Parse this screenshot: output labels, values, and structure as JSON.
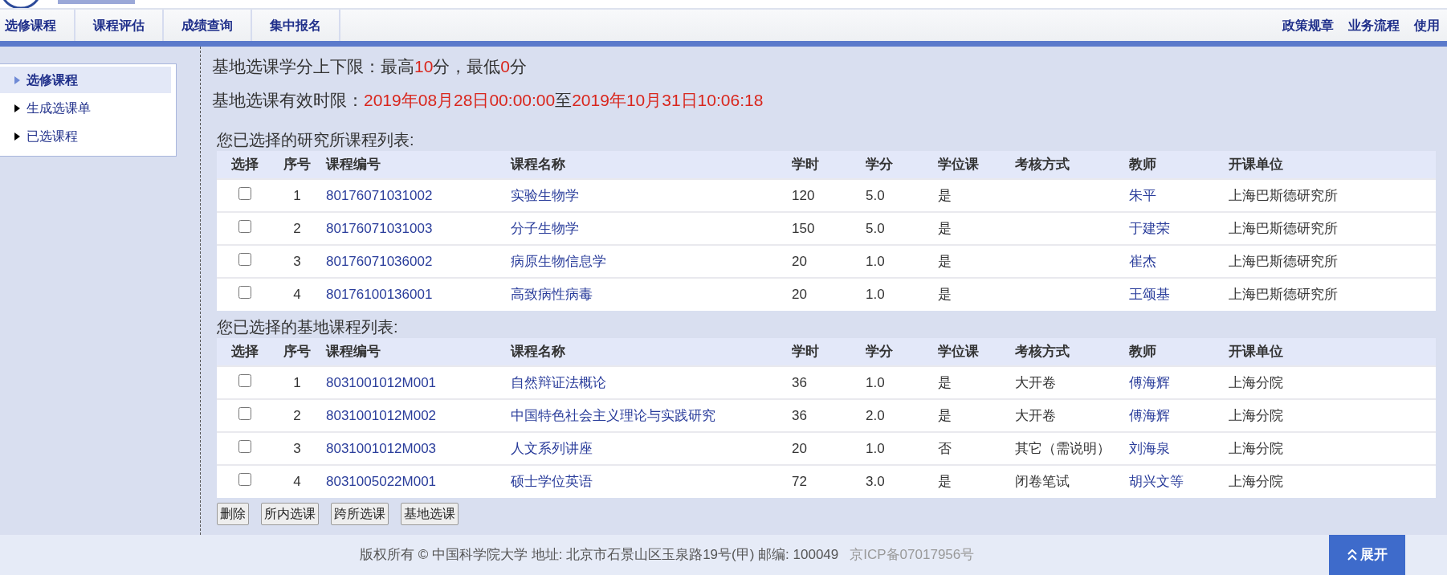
{
  "nav": {
    "left": [
      {
        "label": "选修课程"
      },
      {
        "label": "课程评估"
      },
      {
        "label": "成绩查询"
      },
      {
        "label": "集中报名"
      }
    ],
    "right": [
      {
        "label": "政策规章"
      },
      {
        "label": "业务流程"
      },
      {
        "label": "使用"
      }
    ]
  },
  "sidebar": {
    "items": [
      {
        "label": "选修课程",
        "selected": true
      },
      {
        "label": "生成选课单",
        "selected": false
      },
      {
        "label": "已选课程",
        "selected": false
      }
    ]
  },
  "notices": [
    {
      "segments": [
        {
          "text": "基地选课学分上下限：最高",
          "highlight": false
        },
        {
          "text": "10",
          "highlight": true
        },
        {
          "text": "分，最低",
          "highlight": false
        },
        {
          "text": "0",
          "highlight": true
        },
        {
          "text": "分",
          "highlight": false
        }
      ]
    },
    {
      "segments": [
        {
          "text": "基地选课有效时限：",
          "highlight": false
        },
        {
          "text": "2019年08月28日00:00:00",
          "highlight": true
        },
        {
          "text": "至",
          "highlight": false
        },
        {
          "text": "2019年10月31日10:06:18",
          "highlight": true
        }
      ]
    }
  ],
  "tables": [
    {
      "title": "您已选择的研究所课程列表:",
      "columns": [
        {
          "label": "选择",
          "kind": "check"
        },
        {
          "label": "序号",
          "kind": "index"
        },
        {
          "label": "课程编号",
          "kind": "link"
        },
        {
          "label": "课程名称",
          "kind": "link"
        },
        {
          "label": "学时",
          "kind": "text"
        },
        {
          "label": "学分",
          "kind": "text"
        },
        {
          "label": "学位课",
          "kind": "text"
        },
        {
          "label": "考核方式",
          "kind": "text"
        },
        {
          "label": "教师",
          "kind": "link"
        },
        {
          "label": "开课单位",
          "kind": "text"
        }
      ],
      "rows": [
        {
          "checked": false,
          "cells": [
            "",
            "1",
            "80176071031002",
            "实验生物学",
            "120",
            "5.0",
            "是",
            "",
            "朱平",
            "上海巴斯德研究所"
          ]
        },
        {
          "checked": false,
          "cells": [
            "",
            "2",
            "80176071031003",
            "分子生物学",
            "150",
            "5.0",
            "是",
            "",
            "于建荣",
            "上海巴斯德研究所"
          ]
        },
        {
          "checked": false,
          "cells": [
            "",
            "3",
            "80176071036002",
            "病原生物信息学",
            "20",
            "1.0",
            "是",
            "",
            "崔杰",
            "上海巴斯德研究所"
          ]
        },
        {
          "checked": false,
          "cells": [
            "",
            "4",
            "80176100136001",
            "高致病性病毒",
            "20",
            "1.0",
            "是",
            "",
            "王颂基",
            "上海巴斯德研究所"
          ]
        }
      ]
    },
    {
      "title": "您已选择的基地课程列表:",
      "columns": [
        {
          "label": "选择",
          "kind": "check"
        },
        {
          "label": "序号",
          "kind": "index"
        },
        {
          "label": "课程编号",
          "kind": "link"
        },
        {
          "label": "课程名称",
          "kind": "link"
        },
        {
          "label": "学时",
          "kind": "text"
        },
        {
          "label": "学分",
          "kind": "text"
        },
        {
          "label": "学位课",
          "kind": "text"
        },
        {
          "label": "考核方式",
          "kind": "text"
        },
        {
          "label": "教师",
          "kind": "link"
        },
        {
          "label": "开课单位",
          "kind": "text"
        }
      ],
      "rows": [
        {
          "checked": false,
          "cells": [
            "",
            "1",
            "8031001012M001",
            "自然辩证法概论",
            "36",
            "1.0",
            "是",
            "大开卷",
            "傅海辉",
            "上海分院"
          ]
        },
        {
          "checked": false,
          "cells": [
            "",
            "2",
            "8031001012M002",
            "中国特色社会主义理论与实践研究",
            "36",
            "2.0",
            "是",
            "大开卷",
            "傅海辉",
            "上海分院"
          ]
        },
        {
          "checked": false,
          "cells": [
            "",
            "3",
            "8031001012M003",
            "人文系列讲座",
            "20",
            "1.0",
            "否",
            "其它（需说明）",
            "刘海泉",
            "上海分院"
          ]
        },
        {
          "checked": false,
          "cells": [
            "",
            "4",
            "8031005022M001",
            "硕士学位英语",
            "72",
            "3.0",
            "是",
            "闭卷笔试",
            "胡兴文等",
            "上海分院"
          ]
        }
      ]
    }
  ],
  "buttons": [
    {
      "label": "删除"
    },
    {
      "label": "所内选课"
    },
    {
      "label": "跨所选课"
    },
    {
      "label": "基地选课"
    }
  ],
  "footer": {
    "copyright": "版权所有 © 中国科学院大学 地址: 北京市石景山区玉泉路19号(甲) 邮编: 100049",
    "icp": "京ICP备07017956号",
    "expand": "展开"
  }
}
